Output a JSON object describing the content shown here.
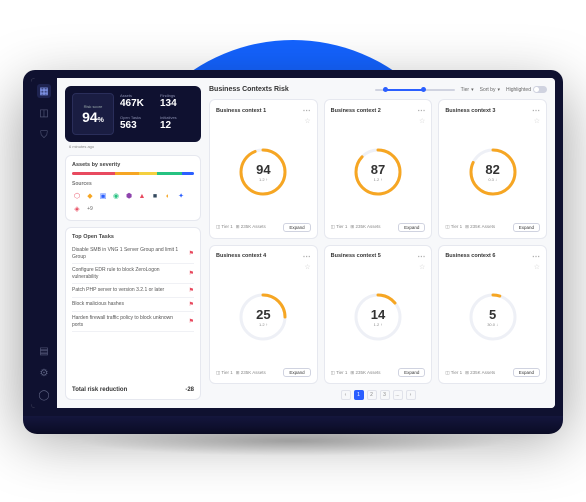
{
  "nav": {
    "items": [
      "grid",
      "chart",
      "shield",
      "report",
      "settings",
      "user"
    ]
  },
  "score": {
    "label": "Risk score",
    "value": "94",
    "sub": "%",
    "time": "6 minutes ago",
    "stats": [
      {
        "label": "Assets",
        "value": "467K"
      },
      {
        "label": "Findings",
        "value": "134"
      },
      {
        "label": "Open Tasks",
        "value": "563"
      },
      {
        "label": "Initiatives",
        "value": "12"
      }
    ]
  },
  "severity": {
    "title": "Assets by severity",
    "hint": "Info",
    "segments": [
      {
        "color": "#e84a5f",
        "pct": 35
      },
      {
        "color": "#f6a623",
        "pct": 20
      },
      {
        "color": "#f4d03f",
        "pct": 15
      },
      {
        "color": "#26c281",
        "pct": 20
      },
      {
        "color": "#2b5fff",
        "pct": 10
      }
    ]
  },
  "sources": {
    "title": "Sources",
    "icons": [
      {
        "glyph": "⬡",
        "color": "#e84a5f"
      },
      {
        "glyph": "◆",
        "color": "#f6a623"
      },
      {
        "glyph": "▣",
        "color": "#2b5fff"
      },
      {
        "glyph": "◉",
        "color": "#26c281"
      },
      {
        "glyph": "⬢",
        "color": "#8e44ad"
      },
      {
        "glyph": "▲",
        "color": "#e84a5f"
      },
      {
        "glyph": "■",
        "color": "#34495e"
      },
      {
        "glyph": "◐",
        "color": "#f6a623"
      },
      {
        "glyph": "✦",
        "color": "#2b5fff"
      },
      {
        "glyph": "◈",
        "color": "#e84a5f"
      }
    ],
    "more": "+9"
  },
  "tasks": {
    "title": "Top Open Tasks",
    "items": [
      {
        "text": "Disable SMB in VNG 1 Server Group and limit 1 Group"
      },
      {
        "text": "Configure EDR rule to block ZeroLogon vulnerability"
      },
      {
        "text": "Patch PHP server to version 3.2.1 or later"
      },
      {
        "text": "Block malicious hashes"
      },
      {
        "text": "Harden firewall traffic policy to block unknown ports"
      }
    ],
    "totalLabel": "Total risk reduction",
    "totalValue": "-28"
  },
  "header": {
    "title": "Business Contexts Risk",
    "tierLabel": "Tier",
    "sortLabel": "Sort by",
    "highlightLabel": "Highlighted"
  },
  "contexts": [
    {
      "title": "Business context 1",
      "score": "94",
      "delta": "1.2 ↑",
      "tier": "Tier 1",
      "assets": "235K Assets"
    },
    {
      "title": "Business context 2",
      "score": "87",
      "delta": "1.2 ↑",
      "tier": "Tier 1",
      "assets": "235K Assets"
    },
    {
      "title": "Business context 3",
      "score": "82",
      "delta": "0.3 ↓",
      "tier": "Tier 1",
      "assets": "235K Assets"
    },
    {
      "title": "Business context 4",
      "score": "25",
      "delta": "1.2 ↑",
      "tier": "Tier 1",
      "assets": "235K Assets"
    },
    {
      "title": "Business context 5",
      "score": "14",
      "delta": "1.2 ↑",
      "tier": "Tier 1",
      "assets": "235K Assets"
    },
    {
      "title": "Business context 6",
      "score": "5",
      "delta": "30.0 ↓",
      "tier": "Tier 1",
      "assets": "235K Assets"
    }
  ],
  "labels": {
    "expand": "Expand"
  },
  "pager": {
    "pages": [
      "1",
      "2",
      "3"
    ],
    "ellipsis": "..."
  }
}
